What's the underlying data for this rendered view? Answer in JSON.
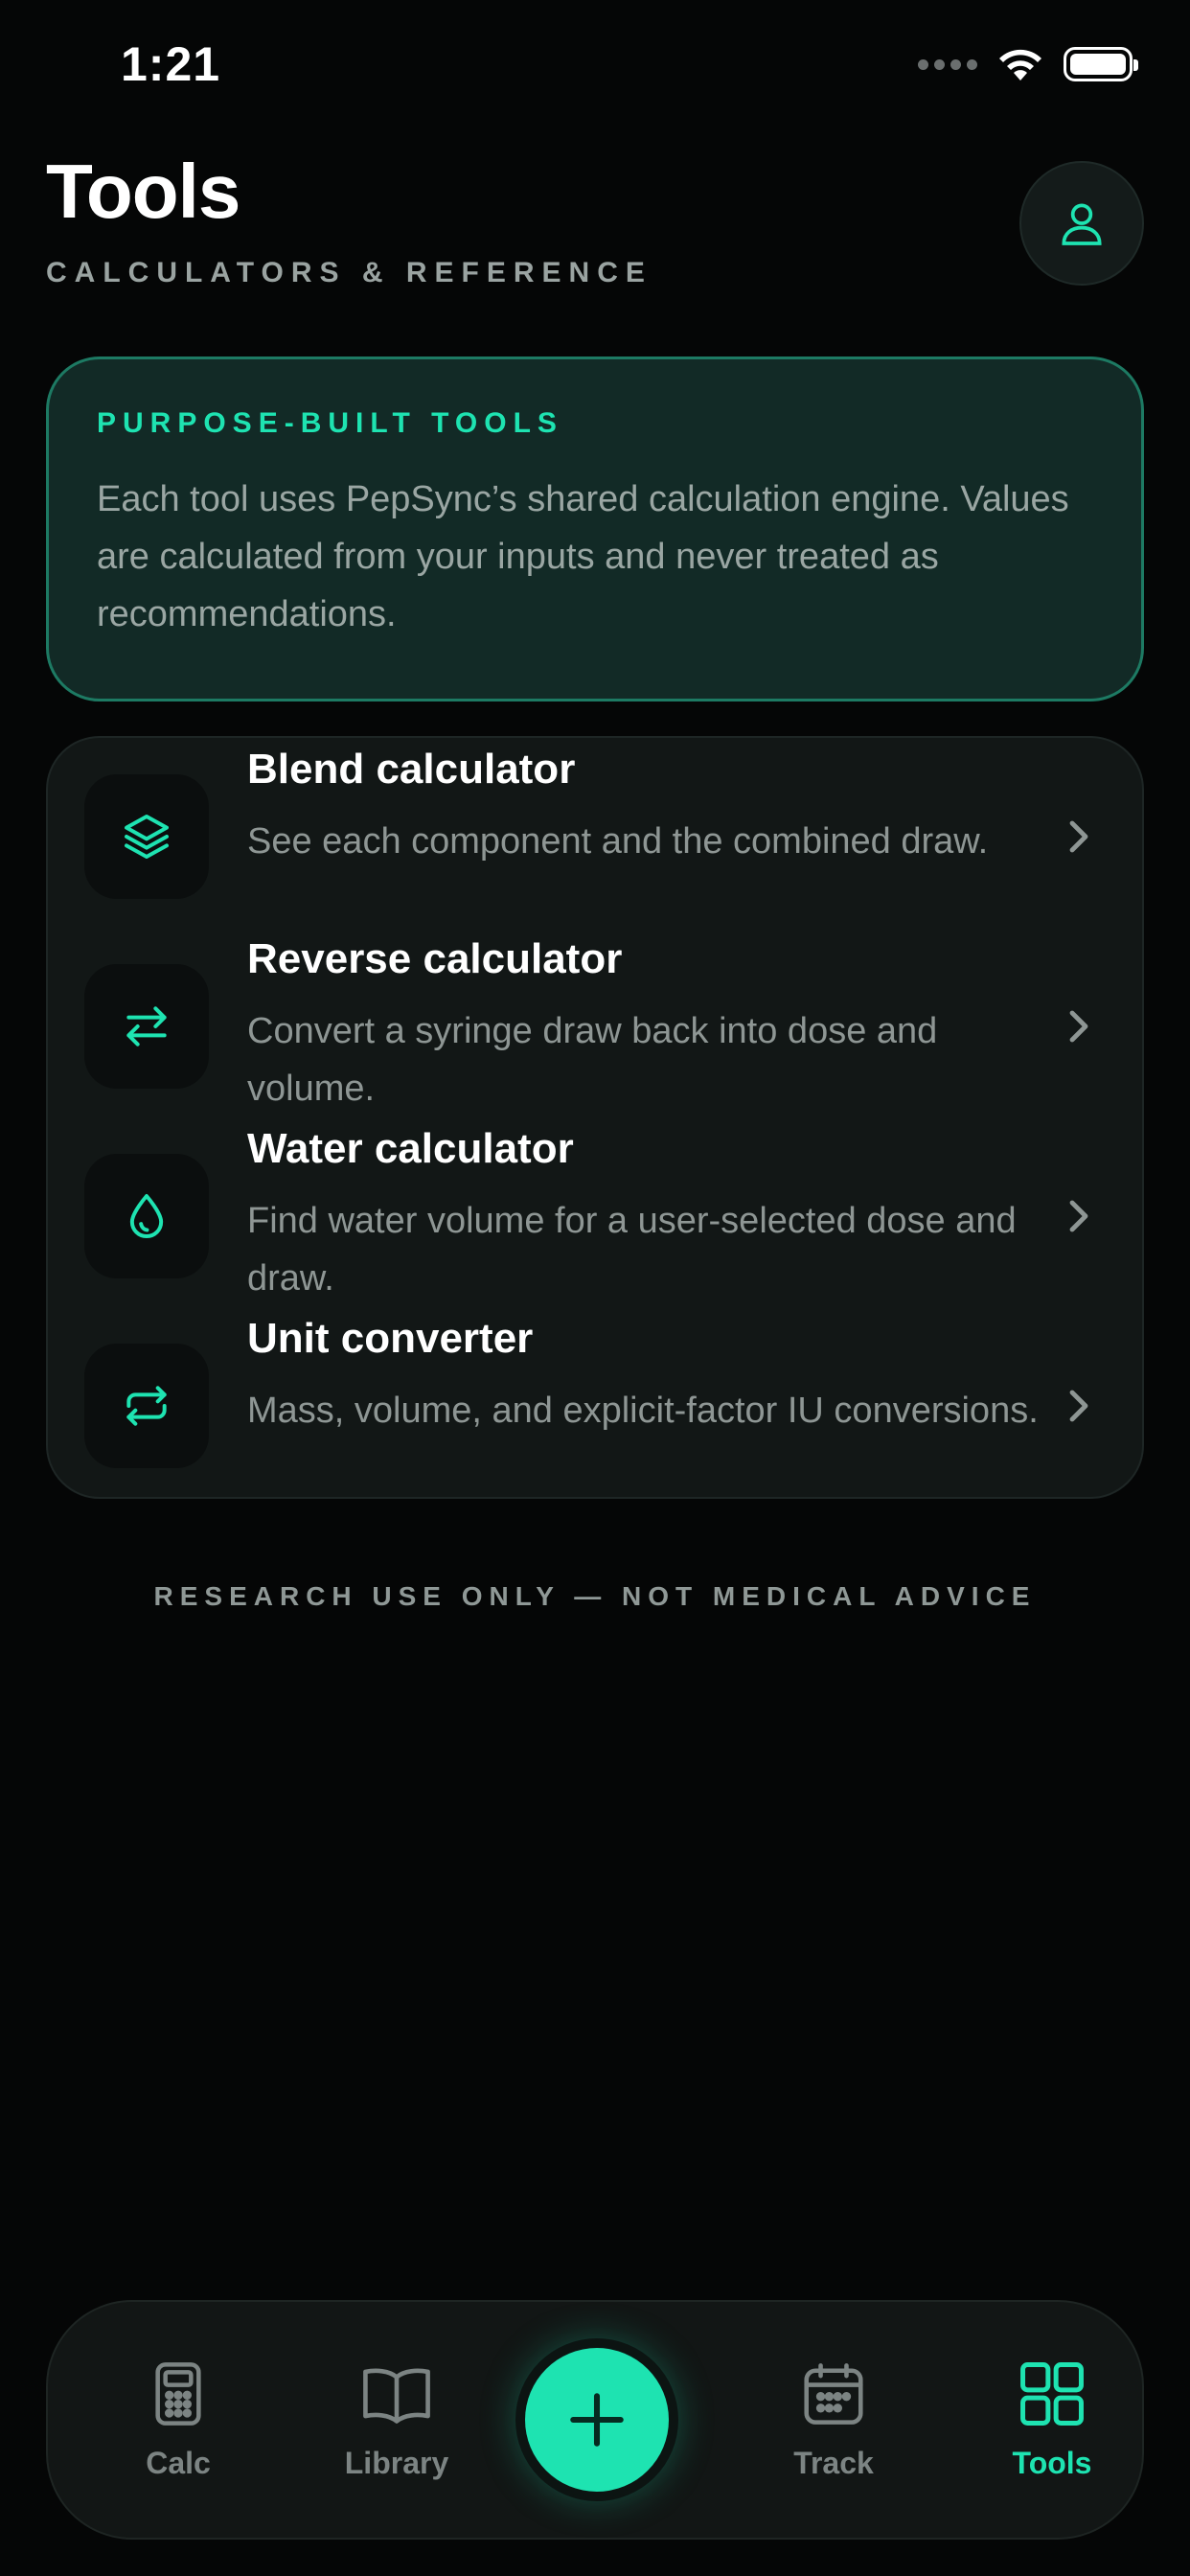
{
  "status_bar": {
    "time": "1:21"
  },
  "header": {
    "title": "Tools",
    "subtitle": "CALCULATORS & REFERENCE",
    "profile_icon": "person-icon"
  },
  "info_card": {
    "label": "PURPOSE-BUILT TOOLS",
    "text": "Each tool uses PepSync’s shared calculation engine. Values are calculated from your inputs and never treated as recommendations."
  },
  "tools": [
    {
      "title": "Blend calculator",
      "description": "See each component and the combined draw.",
      "icon": "layers-icon"
    },
    {
      "title": "Reverse calculator",
      "description": "Convert a syringe draw back into dose and volume.",
      "icon": "swap-arrows-icon"
    },
    {
      "title": "Water calculator",
      "description": "Find water volume for a user-selected dose and draw.",
      "icon": "water-drop-icon"
    },
    {
      "title": "Unit converter",
      "description": "Mass, volume, and explicit-factor IU conversions.",
      "icon": "repeat-icon"
    }
  ],
  "disclaimer": "RESEARCH USE ONLY — NOT MEDICAL ADVICE",
  "tab_bar": {
    "tabs": [
      {
        "label": "Calc",
        "icon": "calculator-icon",
        "active": false
      },
      {
        "label": "Library",
        "icon": "book-icon",
        "active": false
      },
      {
        "label": "Track",
        "icon": "calendar-icon",
        "active": false
      },
      {
        "label": "Tools",
        "icon": "grid-icon",
        "active": true
      }
    ],
    "center_action_icon": "plus-icon"
  },
  "colors": {
    "accent": "#1ee3b1",
    "background": "#050606",
    "card": "#121716",
    "info_card": "#122a26",
    "muted_text": "#8e9694"
  }
}
